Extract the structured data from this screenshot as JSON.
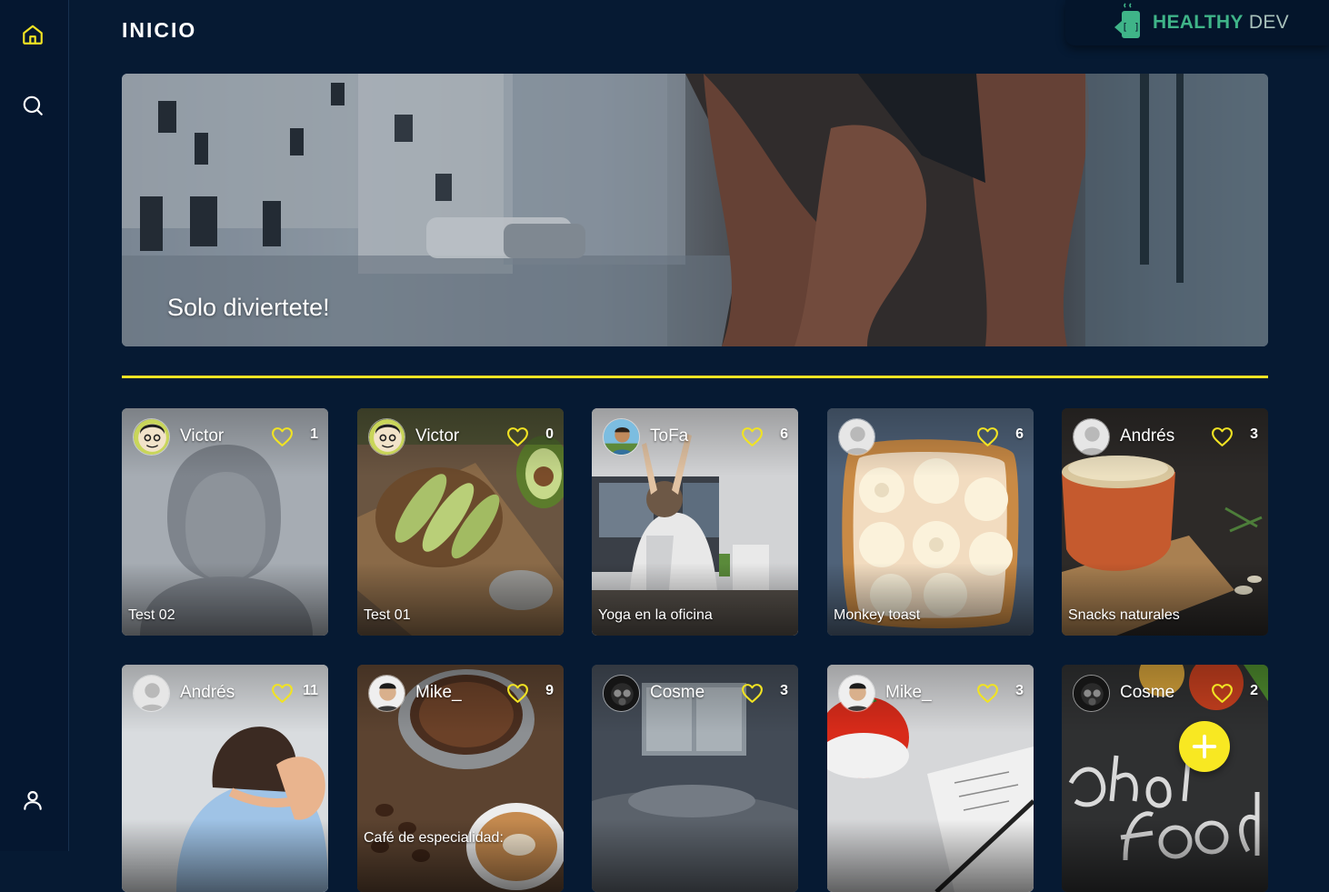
{
  "nav": {
    "items": [
      {
        "name": "home",
        "icon": "home-icon",
        "active": true
      },
      {
        "name": "search",
        "icon": "search-icon",
        "active": false
      },
      {
        "name": "profile",
        "icon": "user-icon",
        "active": false
      }
    ],
    "accent": "#f1e323"
  },
  "page": {
    "title": "INICIO"
  },
  "brand": {
    "word1": "HEALTHY",
    "word2": " DEV",
    "logo_icon": "coffee-cup-code-icon"
  },
  "hero": {
    "caption": "Solo diviertete!"
  },
  "cards": [
    {
      "author": "Victor",
      "likes": "1",
      "title": "Test 02"
    },
    {
      "author": "Victor",
      "likes": "0",
      "title": "Test 01"
    },
    {
      "author": "ToFa",
      "likes": "6",
      "title": "Yoga en la oficina"
    },
    {
      "author": "",
      "likes": "6",
      "title": "Monkey toast"
    },
    {
      "author": "Andrés",
      "likes": "3",
      "title": "Snacks naturales"
    },
    {
      "author": "Andrés",
      "likes": "11",
      "title": ""
    },
    {
      "author": "Mike_",
      "likes": "9",
      "title": "Café de especialidad:"
    },
    {
      "author": "Cosme",
      "likes": "3",
      "title": ""
    },
    {
      "author": "Mike_",
      "likes": "3",
      "title": ""
    },
    {
      "author": "Cosme",
      "likes": "2",
      "title": ""
    }
  ],
  "fab": {
    "icon": "plus-icon"
  },
  "colors": {
    "background": "#061a33",
    "accent": "#f1e323",
    "brand_green": "#3fb488"
  }
}
